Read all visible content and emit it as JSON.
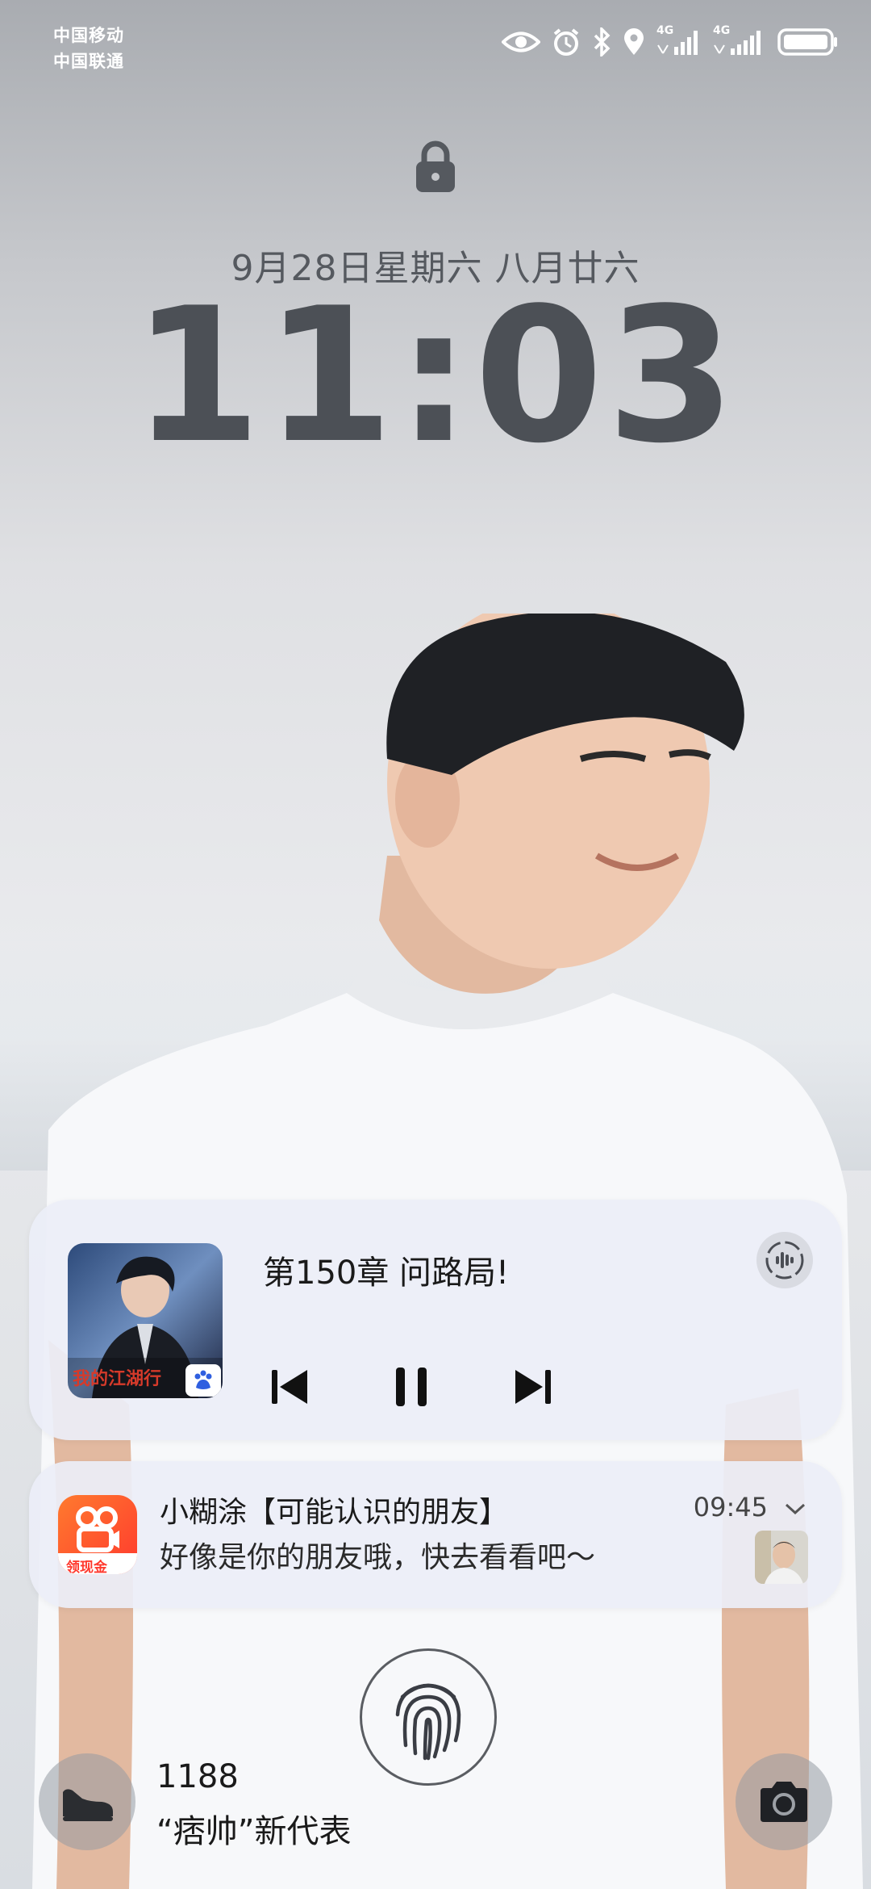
{
  "status_bar": {
    "carrier_1": "中国移动",
    "carrier_2": "中国联通",
    "network_1": "4G",
    "network_2": "4G",
    "icons": [
      "eye-icon",
      "alarm-icon",
      "bluetooth-icon",
      "location-icon",
      "signal-icon",
      "signal-icon",
      "battery-icon"
    ]
  },
  "lock_screen": {
    "date": "9月28日星期六 八月廿六",
    "time": "11:03"
  },
  "media_card": {
    "title": "第150章 问路局!",
    "cover_text": "我的江湖行",
    "controls": [
      "previous",
      "pause",
      "next"
    ]
  },
  "notification": {
    "title": "小糊涂【可能认识的朋友】",
    "body": "好像是你的朋友哦，快去看看吧～",
    "time": "09:45",
    "app_badge": "领现金"
  },
  "bottom": {
    "steps": "1188",
    "caption": "“痞帅”新代表"
  },
  "colors": {
    "card_bg": "#eceef7",
    "time_color": "#4c5056",
    "app_icon": "#ff4d2e"
  }
}
